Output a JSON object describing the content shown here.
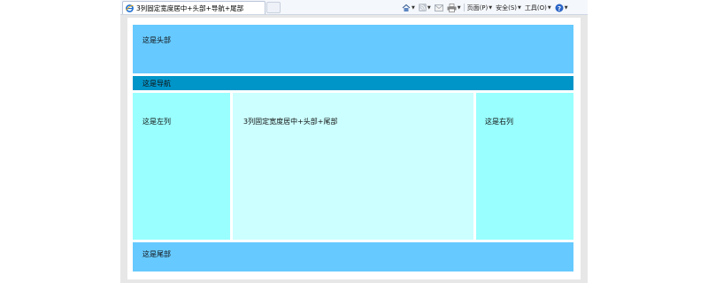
{
  "browser": {
    "tab_title": "3列固定宽度居中+头部+导航+尾部",
    "toolbar": {
      "page_label": "页面(P)",
      "safety_label": "安全(S)",
      "tools_label": "工具(O)"
    }
  },
  "layout": {
    "header_text": "这是头部",
    "nav_text": "这是导航",
    "left_text": "这是左列",
    "main_text": "3列固定宽度居中+头部+尾部",
    "right_text": "这是右列",
    "footer_text": "这是尾部"
  },
  "colors": {
    "header": "#66c9ff",
    "nav": "#0095c9",
    "side_columns": "#99ffff",
    "main_column": "#ccffff",
    "footer": "#66c9ff"
  },
  "icons": [
    "ie-page-icon",
    "home-icon",
    "rss-icon",
    "mail-icon",
    "print-icon",
    "help-icon"
  ]
}
